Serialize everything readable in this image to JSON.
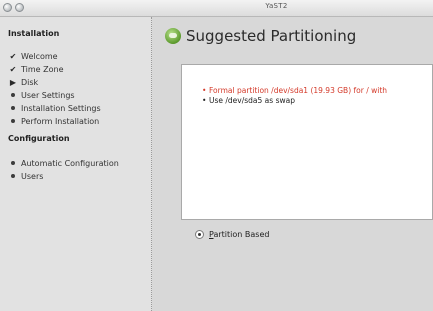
{
  "window": {
    "title": "YaST2"
  },
  "sidebar": {
    "installation_heading": "Installation",
    "installation_steps": [
      {
        "label": "Welcome",
        "status": "done"
      },
      {
        "label": "Time Zone",
        "status": "done"
      },
      {
        "label": "Disk",
        "status": "current"
      },
      {
        "label": "User Settings",
        "status": "pending"
      },
      {
        "label": "Installation Settings",
        "status": "pending"
      },
      {
        "label": "Perform Installation",
        "status": "pending"
      }
    ],
    "configuration_heading": "Configuration",
    "configuration_steps": [
      {
        "label": "Automatic Configuration",
        "status": "pending"
      },
      {
        "label": "Users",
        "status": "pending"
      }
    ]
  },
  "main": {
    "title": "Suggested Partitioning",
    "title_icon": "disk-partition-icon",
    "summary": [
      {
        "text": "Formal partition /dev/sda1 (19.93 GB) for / with",
        "style": "warning",
        "color": "#d43a2a"
      },
      {
        "text": "Use /dev/sda5 as swap",
        "style": "normal",
        "color": "#222222"
      }
    ],
    "option": {
      "label": "Partition Based",
      "selected": true
    }
  }
}
